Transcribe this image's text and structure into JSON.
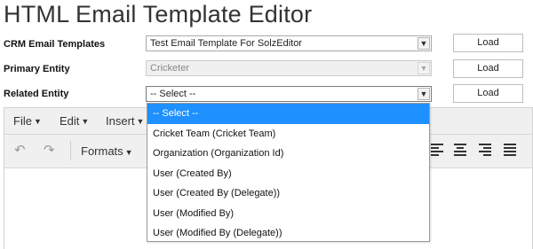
{
  "page": {
    "title": "HTML Email Template Editor"
  },
  "form": {
    "rows": [
      {
        "label": "CRM Email Templates",
        "value": "Test Email Template For SolzEditor",
        "button": "Load"
      },
      {
        "label": "Primary Entity",
        "value": "Cricketer",
        "button": "Load"
      },
      {
        "label": "Related Entity",
        "value": "-- Select --",
        "button": "Load"
      }
    ]
  },
  "editor": {
    "menu": [
      "File",
      "Edit",
      "Insert"
    ],
    "toolbar": {
      "formats_label": "Formats",
      "undo_icon": "undo-icon",
      "redo_icon": "redo-icon"
    }
  },
  "dropdown": {
    "options": [
      "-- Select --",
      "Cricket Team (Cricket Team)",
      "Organization (Organization Id)",
      "User (Created By)",
      "User (Created By (Delegate))",
      "User (Modified By)",
      "User (Modified By (Delegate))"
    ],
    "selected_index": 0,
    "highlight_color": "#1e90ff"
  }
}
